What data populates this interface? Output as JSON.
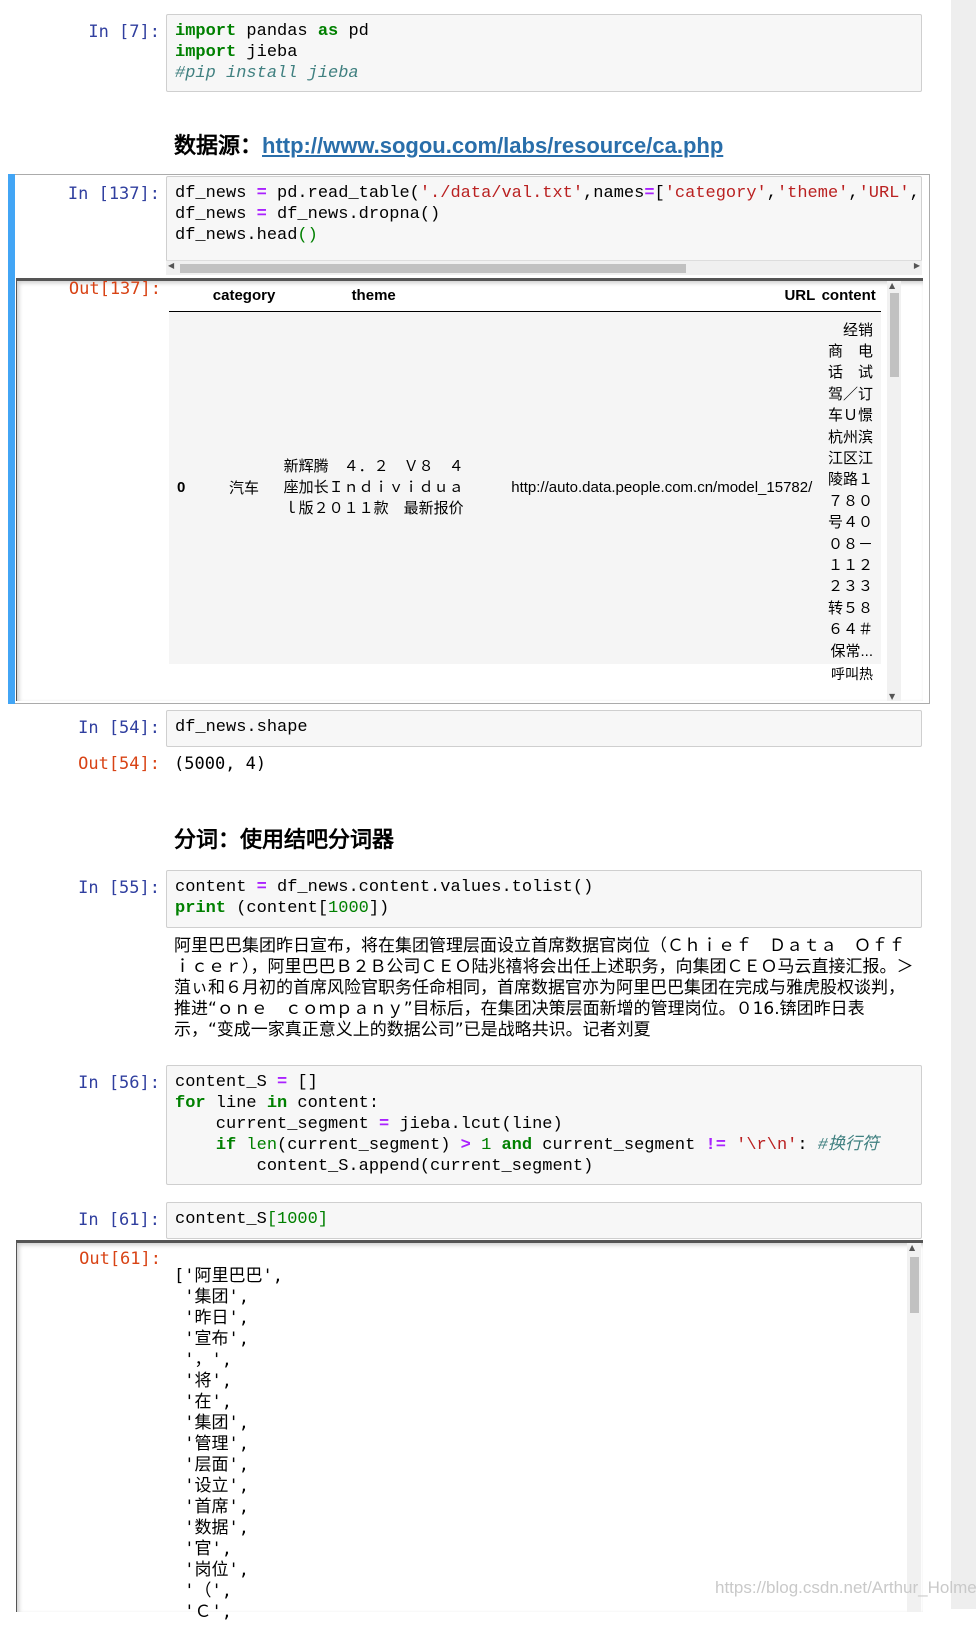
{
  "cells": {
    "c7": {
      "prompt": "In [7]:"
    },
    "heading_source": {
      "label": "数据源：",
      "link": "http://www.sogou.com/labs/resource/ca.php"
    },
    "c137": {
      "prompt": "In [137]:",
      "out_prompt": "Out[137]:",
      "table": {
        "columns": [
          "category",
          "theme",
          "URL",
          "content"
        ],
        "row_index": "0",
        "category": "汽车",
        "theme_lines": [
          "新辉腾　４．２　Ｖ８　４",
          "座加长Ｉｎｄｉｖｉｄｕａ",
          "ｌ版２０１１款　最新报价"
        ],
        "url": "http://auto.data.people.com.cn/model_15782/",
        "content_lines": [
          "经销",
          "商　电",
          "话　试",
          "驾／订",
          "车Ｕ憬",
          "杭州滨",
          "江区江",
          "陵路１",
          "７８０",
          "号４０",
          "０８－",
          "１１２",
          "２３３",
          "转５８",
          "６４＃",
          "保常..."
        ],
        "next_row_fragment": "呼叫热"
      }
    },
    "c54": {
      "prompt": "In [54]:",
      "code": "df_news.shape",
      "out_prompt": "Out[54]:",
      "output": "(5000, 4)"
    },
    "heading_seg": {
      "label": "分词：使用结吧分词器"
    },
    "c55": {
      "prompt": "In [55]:",
      "stdout": "阿里巴巴集团昨日宣布，将在集团管理层面设立首席数据官岗位（Ｃｈｉｅｆ　Ｄａｔａ　Ｏｆｆｉｃｅｒ），阿里巴巴Ｂ２Ｂ公司ＣＥＯ陆兆禧将会出任上述职务，向集团ＣＥＯ马云直接汇报。＞菹ぃ和６月初的首席风险官职务任命相同，首席数据官亦为阿里巴巴集团在完成与雅虎股权谈判，推进“ｏｎｅ　ｃｏｍｐａｎｙ”目标后，在集团决策层面新增的管理岗位。０16.锛团昨日表示，“变成一家真正意义上的数据公司”已是战略共识。记者刘夏"
    },
    "c56": {
      "prompt": "In [56]:"
    },
    "c61": {
      "prompt": "In [61]:",
      "out_prompt": "Out[61]:",
      "list_lines": [
        "['阿里巴巴',",
        " '集团',",
        " '昨日',",
        " '宣布',",
        " '，',",
        " '将',",
        " '在',",
        " '集团',",
        " '管理',",
        " '层面',",
        " '设立',",
        " '首席',",
        " '数据',",
        " '官',",
        " '岗位',",
        " '（',",
        " 'Ｃ',"
      ]
    }
  },
  "watermark": "https://blog.csdn.net/Arthur_Holmes",
  "colors": {
    "prompt_in": "#303f9f",
    "prompt_out": "#d84315",
    "selected_bar": "#42a5f5",
    "link": "#296eaa"
  }
}
